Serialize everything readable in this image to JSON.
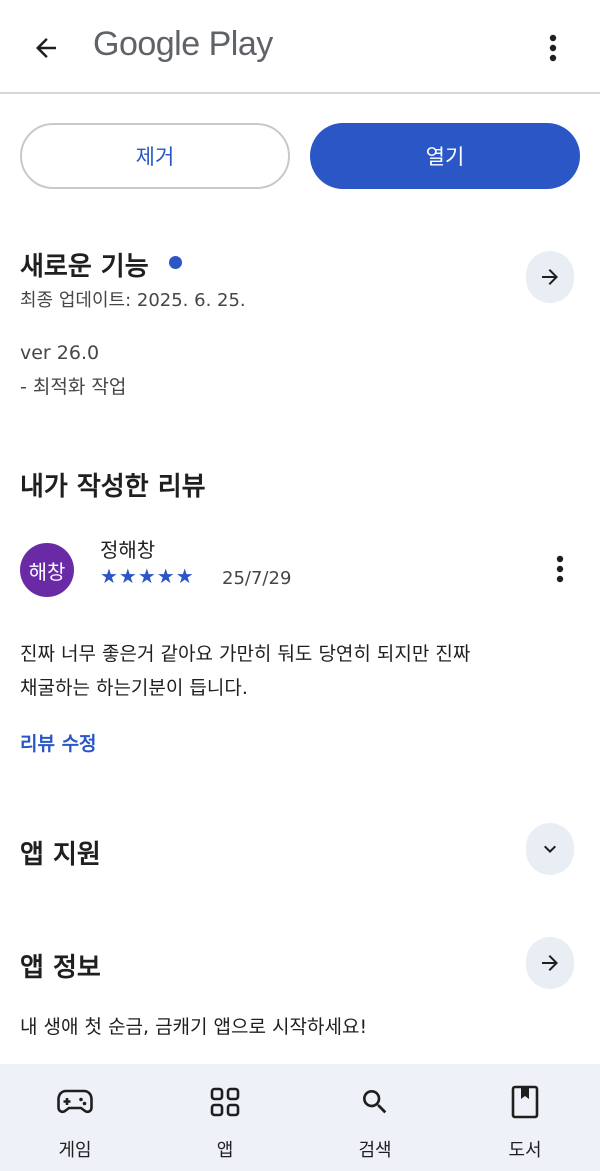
{
  "header": {
    "back_icon": "arrow-back-icon",
    "brand": "Google Play",
    "more_icon": "more-vert-icon"
  },
  "actions": {
    "uninstall_label": "제거",
    "open_label": "열기"
  },
  "whats_new": {
    "title": "새로운 기능",
    "last_updated": "최종 업데이트: 2025. 6. 25.",
    "version": "ver 26.0",
    "notes": "- 최적화 작업",
    "arrow_icon": "arrow-forward-icon"
  },
  "my_review": {
    "title": "내가 작성한 리뷰",
    "avatar_text": "해창",
    "reviewer_name": "정해창",
    "stars": "★★★★★",
    "rating": 5,
    "date": "25/7/29",
    "text_line1": "진짜 너무 좋은거 같아요 가만히 둬도 당연히 되지만 진짜",
    "text_line2": "채굴하는 하는기분이 듭니다.",
    "edit_label": "리뷰 수정"
  },
  "app_support": {
    "title": "앱 지원",
    "expand_icon": "chevron-down-icon"
  },
  "about_app": {
    "title": "앱 정보",
    "description": "내 생애 첫 순금, 금캐기 앱으로 시작하세요!",
    "arrow_icon": "arrow-forward-icon"
  },
  "bottom_nav": [
    {
      "label": "게임",
      "icon": "gamepad-icon"
    },
    {
      "label": "앱",
      "icon": "apps-grid-icon"
    },
    {
      "label": "검색",
      "icon": "search-icon"
    },
    {
      "label": "도서",
      "icon": "book-icon"
    }
  ],
  "colors": {
    "accent": "#2a56c6",
    "avatar": "#6a2aa6",
    "nav_background": "#eef1f7"
  }
}
